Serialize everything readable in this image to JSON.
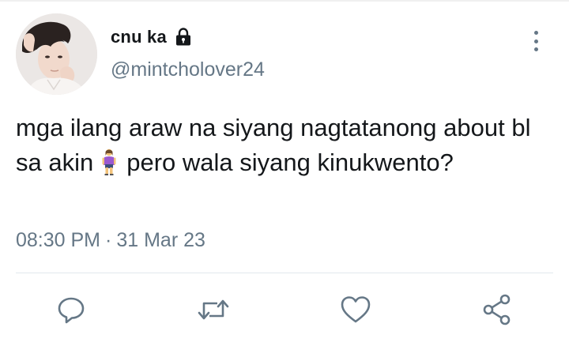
{
  "user": {
    "display_name": "cnu ka",
    "handle": "@mintcholover24",
    "protected_icon": "lock-icon"
  },
  "tweet": {
    "text_before_emoji": "mga ilang araw na siyang nagtatanong about bl sa akin",
    "emoji": "woman-standing-emoji",
    "text_after_emoji": "pero wala siyang kinukwento?",
    "time": "08:30 PM",
    "separator": "·",
    "date": "31 Mar 23"
  },
  "actions": [
    {
      "name": "reply",
      "icon": "comment-icon"
    },
    {
      "name": "retweet",
      "icon": "retweet-icon"
    },
    {
      "name": "like",
      "icon": "heart-icon"
    },
    {
      "name": "share",
      "icon": "share-icon"
    }
  ],
  "colors": {
    "text_primary": "#14171a",
    "text_secondary": "#657786",
    "icon": "#657786",
    "divider": "#e1e8ed"
  }
}
